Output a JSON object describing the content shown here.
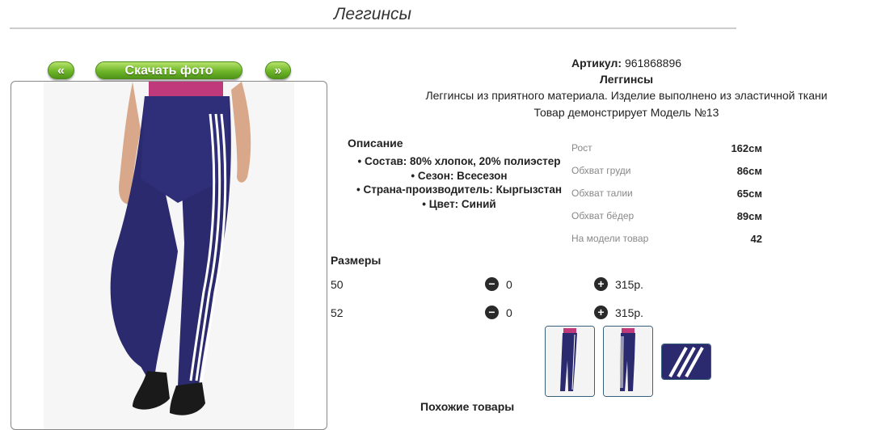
{
  "page": {
    "title": "Леггинсы"
  },
  "gallery": {
    "prev_label": "«",
    "download_label": "Скачать фото",
    "next_label": "»"
  },
  "product": {
    "article_label": "Артикул:",
    "article_value": "961868896",
    "name": "Леггинсы",
    "description": "Леггинсы из приятного материала. Изделие выполнено из эластичной ткани",
    "model_note": "Товар демонстрирует Модель №13"
  },
  "description": {
    "title": "Описание",
    "items": [
      "Состав: 80% хлопок, 20% полиэстер",
      "Сезон: Всесезон",
      "Страна-производитель: Кыргызстан",
      "Цвет: Синий"
    ]
  },
  "measurements": [
    {
      "label": "Рост",
      "value": "162см"
    },
    {
      "label": "Обхват груди",
      "value": "86см"
    },
    {
      "label": "Обхват талии",
      "value": "65см"
    },
    {
      "label": "Обхват бёдер",
      "value": "89см"
    },
    {
      "label": "На модели товар",
      "value": "42"
    }
  ],
  "sizes": {
    "title": "Размеры",
    "minus_icon": "minus-circle-icon",
    "plus_icon": "plus-circle-icon",
    "rows": [
      {
        "size": "50",
        "qty": "0",
        "price": "315р."
      },
      {
        "size": "52",
        "qty": "0",
        "price": "315р."
      }
    ]
  },
  "similar": {
    "title": "Похожие товары"
  },
  "colors": {
    "accent_green": "#6fb62a",
    "product_navy": "#2b2a6e",
    "thumb_border": "#3a5f7a"
  }
}
